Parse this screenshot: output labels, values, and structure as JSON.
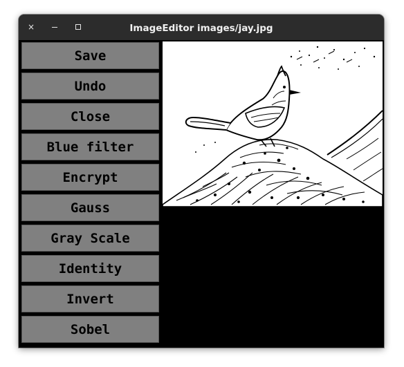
{
  "window": {
    "title": "ImageEditor images/jay.jpg",
    "controls": {
      "close_glyph": "×",
      "minimize_glyph": "–",
      "maximize_glyph": "□"
    }
  },
  "sidebar": {
    "buttons": [
      {
        "label": "Save"
      },
      {
        "label": "Undo"
      },
      {
        "label": "Close"
      },
      {
        "label": "Blue filter"
      },
      {
        "label": "Encrypt"
      },
      {
        "label": "Gauss"
      },
      {
        "label": "Gray Scale"
      },
      {
        "label": "Identity"
      },
      {
        "label": "Invert"
      },
      {
        "label": "Sobel"
      }
    ]
  },
  "image": {
    "subject": "jay",
    "colors": {
      "ink": "#000000",
      "paper": "#ffffff"
    }
  },
  "colors": {
    "titlebar": "#2c2c2c",
    "button_bg": "#808080",
    "background": "#000000"
  }
}
